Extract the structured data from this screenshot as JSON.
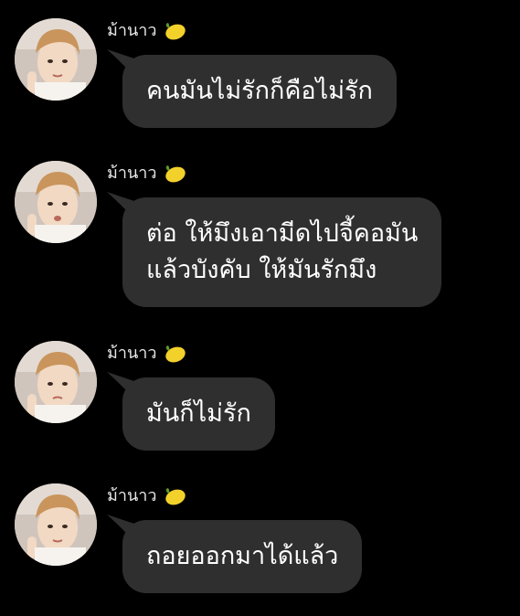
{
  "chat": {
    "messages": [
      {
        "sender": "ม้านาว",
        "sender_icon": "lemon-icon",
        "lines": [
          "คนมันไม่รักก็คือไม่รัก"
        ]
      },
      {
        "sender": "ม้านาว",
        "sender_icon": "lemon-icon",
        "lines": [
          "ต่อ ให้มึงเอามีดไปจี้คอมัน",
          "แล้วบังคับ ให้มันรักมึง"
        ]
      },
      {
        "sender": "ม้านาว",
        "sender_icon": "lemon-icon",
        "lines": [
          "มันก็ไม่รัก"
        ]
      },
      {
        "sender": "ม้านาว",
        "sender_icon": "lemon-icon",
        "lines": [
          "ถอยออกมาได้แล้ว"
        ]
      }
    ]
  },
  "colors": {
    "background": "#000000",
    "bubble": "#2f2f2f",
    "text": "#ffffff",
    "sender_text": "#e8e8e8",
    "lemon": "#f3d12b"
  }
}
